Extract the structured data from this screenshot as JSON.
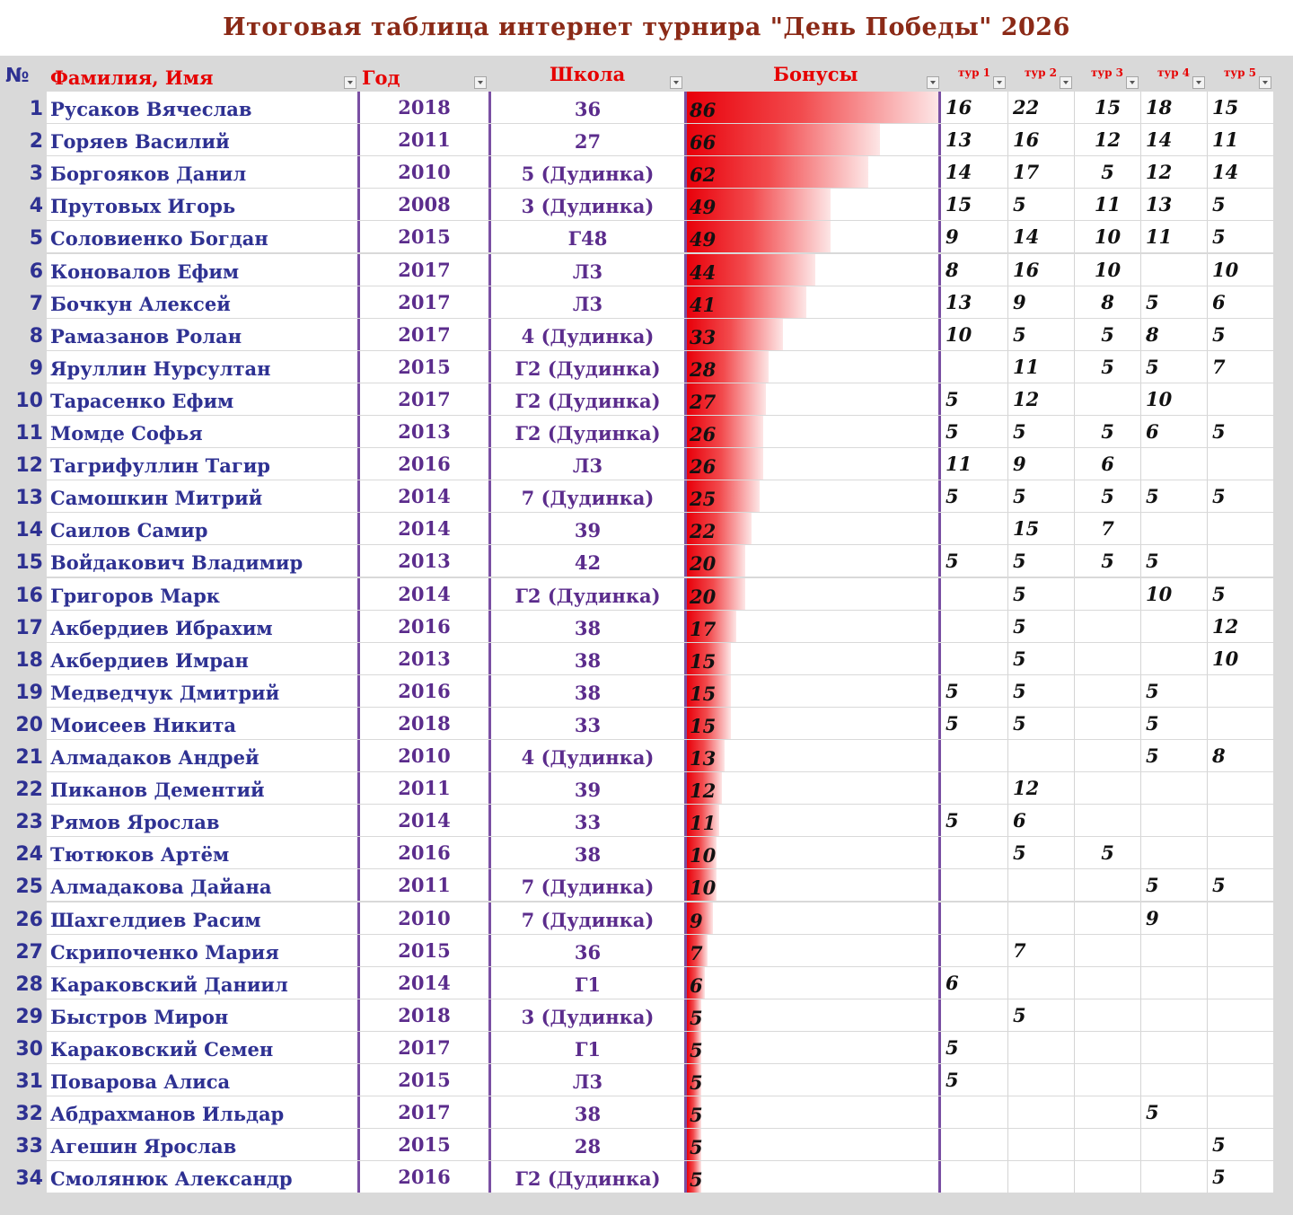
{
  "title": "Итоговая таблица интернет турнира  \"День Победы\" 2026",
  "headers": {
    "num": "№",
    "name": "Фамилия, Имя",
    "year": "Год",
    "school": "Школа",
    "bonus": "Бонусы",
    "tours": [
      "тур 1",
      "тур 2",
      "тур 3",
      "тур 4",
      "тур 5"
    ]
  },
  "colors": {
    "title": "#8b2a17",
    "header": "#e60000",
    "name": "#2e3192",
    "bar": "#e8000a"
  },
  "icons": {
    "filter": "filter-dropdown-icon"
  },
  "max_bonus": 86,
  "rows": [
    {
      "n": "1",
      "name": "Русаков Вячеслав",
      "year": "2018",
      "school": "36",
      "bonus": 86,
      "t": [
        "16",
        "22",
        "15",
        "18",
        "15"
      ]
    },
    {
      "n": "2",
      "name": "Горяев Василий",
      "year": "2011",
      "school": "27",
      "bonus": 66,
      "t": [
        "13",
        "16",
        "12",
        "14",
        "11"
      ]
    },
    {
      "n": "3",
      "name": "Боргояков Данил",
      "year": "2010",
      "school": "5 (Дудинка)",
      "bonus": 62,
      "t": [
        "14",
        "17",
        "5",
        "12",
        "14"
      ]
    },
    {
      "n": "4",
      "name": "Прутовых Игорь",
      "year": "2008",
      "school": "3 (Дудинка)",
      "bonus": 49,
      "t": [
        "15",
        "5",
        "11",
        "13",
        "5"
      ]
    },
    {
      "n": "5",
      "name": "Соловиенко Богдан",
      "year": "2015",
      "school": "Г48",
      "bonus": 49,
      "t": [
        "9",
        "14",
        "10",
        "11",
        "5"
      ]
    },
    {
      "n": "6",
      "name": "Коновалов Ефим",
      "year": "2017",
      "school": "Л3",
      "bonus": 44,
      "t": [
        "8",
        "16",
        "10",
        "",
        "10"
      ]
    },
    {
      "n": "7",
      "name": "Бочкун Алексей",
      "year": "2017",
      "school": "Л3",
      "bonus": 41,
      "t": [
        "13",
        "9",
        "8",
        "5",
        "6"
      ]
    },
    {
      "n": "8",
      "name": "Рамазанов Ролан",
      "year": "2017",
      "school": "4 (Дудинка)",
      "bonus": 33,
      "t": [
        "10",
        "5",
        "5",
        "8",
        "5"
      ]
    },
    {
      "n": "9",
      "name": "Яруллин Нурсултан",
      "year": "2015",
      "school": "Г2 (Дудинка)",
      "bonus": 28,
      "t": [
        "",
        "11",
        "5",
        "5",
        "7"
      ]
    },
    {
      "n": "10",
      "name": "Тарасенко Ефим",
      "year": "2017",
      "school": "Г2 (Дудинка)",
      "bonus": 27,
      "t": [
        "5",
        "12",
        "",
        "10",
        ""
      ]
    },
    {
      "n": "11",
      "name": "Момде Софья",
      "year": "2013",
      "school": "Г2 (Дудинка)",
      "bonus": 26,
      "t": [
        "5",
        "5",
        "5",
        "6",
        "5"
      ]
    },
    {
      "n": "12",
      "name": "Тагрифуллин Тагир",
      "year": "2016",
      "school": "Л3",
      "bonus": 26,
      "t": [
        "11",
        "9",
        "6",
        "",
        ""
      ]
    },
    {
      "n": "13",
      "name": "Самошкин Митрий",
      "year": "2014",
      "school": "7 (Дудинка)",
      "bonus": 25,
      "t": [
        "5",
        "5",
        "5",
        "5",
        "5"
      ]
    },
    {
      "n": "14",
      "name": "Саилов Самир",
      "year": "2014",
      "school": "39",
      "bonus": 22,
      "t": [
        "",
        "15",
        "7",
        "",
        ""
      ]
    },
    {
      "n": "15",
      "name": "Войдакович Владимир",
      "year": "2013",
      "school": "42",
      "bonus": 20,
      "t": [
        "5",
        "5",
        "5",
        "5",
        ""
      ]
    },
    {
      "n": "16",
      "name": "Григоров Марк",
      "year": "2014",
      "school": "Г2 (Дудинка)",
      "bonus": 20,
      "t": [
        "",
        "5",
        "",
        "10",
        "5"
      ]
    },
    {
      "n": "17",
      "name": "Акбердиев Ибрахим",
      "year": "2016",
      "school": "38",
      "bonus": 17,
      "t": [
        "",
        "5",
        "",
        "",
        "12"
      ]
    },
    {
      "n": "18",
      "name": "Акбердиев Имран",
      "year": "2013",
      "school": "38",
      "bonus": 15,
      "t": [
        "",
        "5",
        "",
        "",
        "10"
      ]
    },
    {
      "n": "19",
      "name": "Медведчук Дмитрий",
      "year": "2016",
      "school": "38",
      "bonus": 15,
      "t": [
        "5",
        "5",
        "",
        "5",
        ""
      ]
    },
    {
      "n": "20",
      "name": "Моисеев Никита",
      "year": "2018",
      "school": "33",
      "bonus": 15,
      "t": [
        "5",
        "5",
        "",
        "5",
        ""
      ]
    },
    {
      "n": "21",
      "name": "Алмадаков Андрей",
      "year": "2010",
      "school": "4 (Дудинка)",
      "bonus": 13,
      "t": [
        "",
        "",
        "",
        "5",
        "8"
      ]
    },
    {
      "n": "22",
      "name": "Пиканов Дементий",
      "year": "2011",
      "school": "39",
      "bonus": 12,
      "t": [
        "",
        "12",
        "",
        "",
        ""
      ]
    },
    {
      "n": "23",
      "name": "Рямов Ярослав",
      "year": "2014",
      "school": "33",
      "bonus": 11,
      "t": [
        "5",
        "6",
        "",
        "",
        ""
      ]
    },
    {
      "n": "24",
      "name": "Тютюков Артём",
      "year": "2016",
      "school": "38",
      "bonus": 10,
      "t": [
        "",
        "5",
        "5",
        "",
        ""
      ]
    },
    {
      "n": "25",
      "name": "Алмадакова Дайана",
      "year": "2011",
      "school": "7 (Дудинка)",
      "bonus": 10,
      "t": [
        "",
        "",
        "",
        "5",
        "5"
      ]
    },
    {
      "n": "26",
      "name": "Шахгелдиев Расим",
      "year": "2010",
      "school": "7 (Дудинка)",
      "bonus": 9,
      "t": [
        "",
        "",
        "",
        "9",
        ""
      ]
    },
    {
      "n": "27",
      "name": "Скрипоченко Мария",
      "year": "2015",
      "school": "36",
      "bonus": 7,
      "t": [
        "",
        "7",
        "",
        "",
        ""
      ]
    },
    {
      "n": "28",
      "name": "Караковский Даниил",
      "year": "2014",
      "school": "Г1",
      "bonus": 6,
      "t": [
        "6",
        "",
        "",
        "",
        ""
      ]
    },
    {
      "n": "29",
      "name": "Быстров Мирон",
      "year": "2018",
      "school": "3 (Дудинка)",
      "bonus": 5,
      "t": [
        "",
        "5",
        "",
        "",
        ""
      ]
    },
    {
      "n": "30",
      "name": "Караковский Семен",
      "year": "2017",
      "school": "Г1",
      "bonus": 5,
      "t": [
        "5",
        "",
        "",
        "",
        ""
      ]
    },
    {
      "n": "31",
      "name": "Поварова Алиса",
      "year": "2015",
      "school": "Л3",
      "bonus": 5,
      "t": [
        "5",
        "",
        "",
        "",
        ""
      ]
    },
    {
      "n": "32",
      "name": "Абдрахманов Ильдар",
      "year": "2017",
      "school": "38",
      "bonus": 5,
      "t": [
        "",
        "",
        "",
        "5",
        ""
      ]
    },
    {
      "n": "33",
      "name": "Агешин Ярослав",
      "year": "2015",
      "school": "28",
      "bonus": 5,
      "t": [
        "",
        "",
        "",
        "",
        "5"
      ]
    },
    {
      "n": "34",
      "name": "Смолянюк Александр",
      "year": "2016",
      "school": "Г2 (Дудинка)",
      "bonus": 5,
      "t": [
        "",
        "",
        "",
        "",
        "5"
      ]
    }
  ]
}
